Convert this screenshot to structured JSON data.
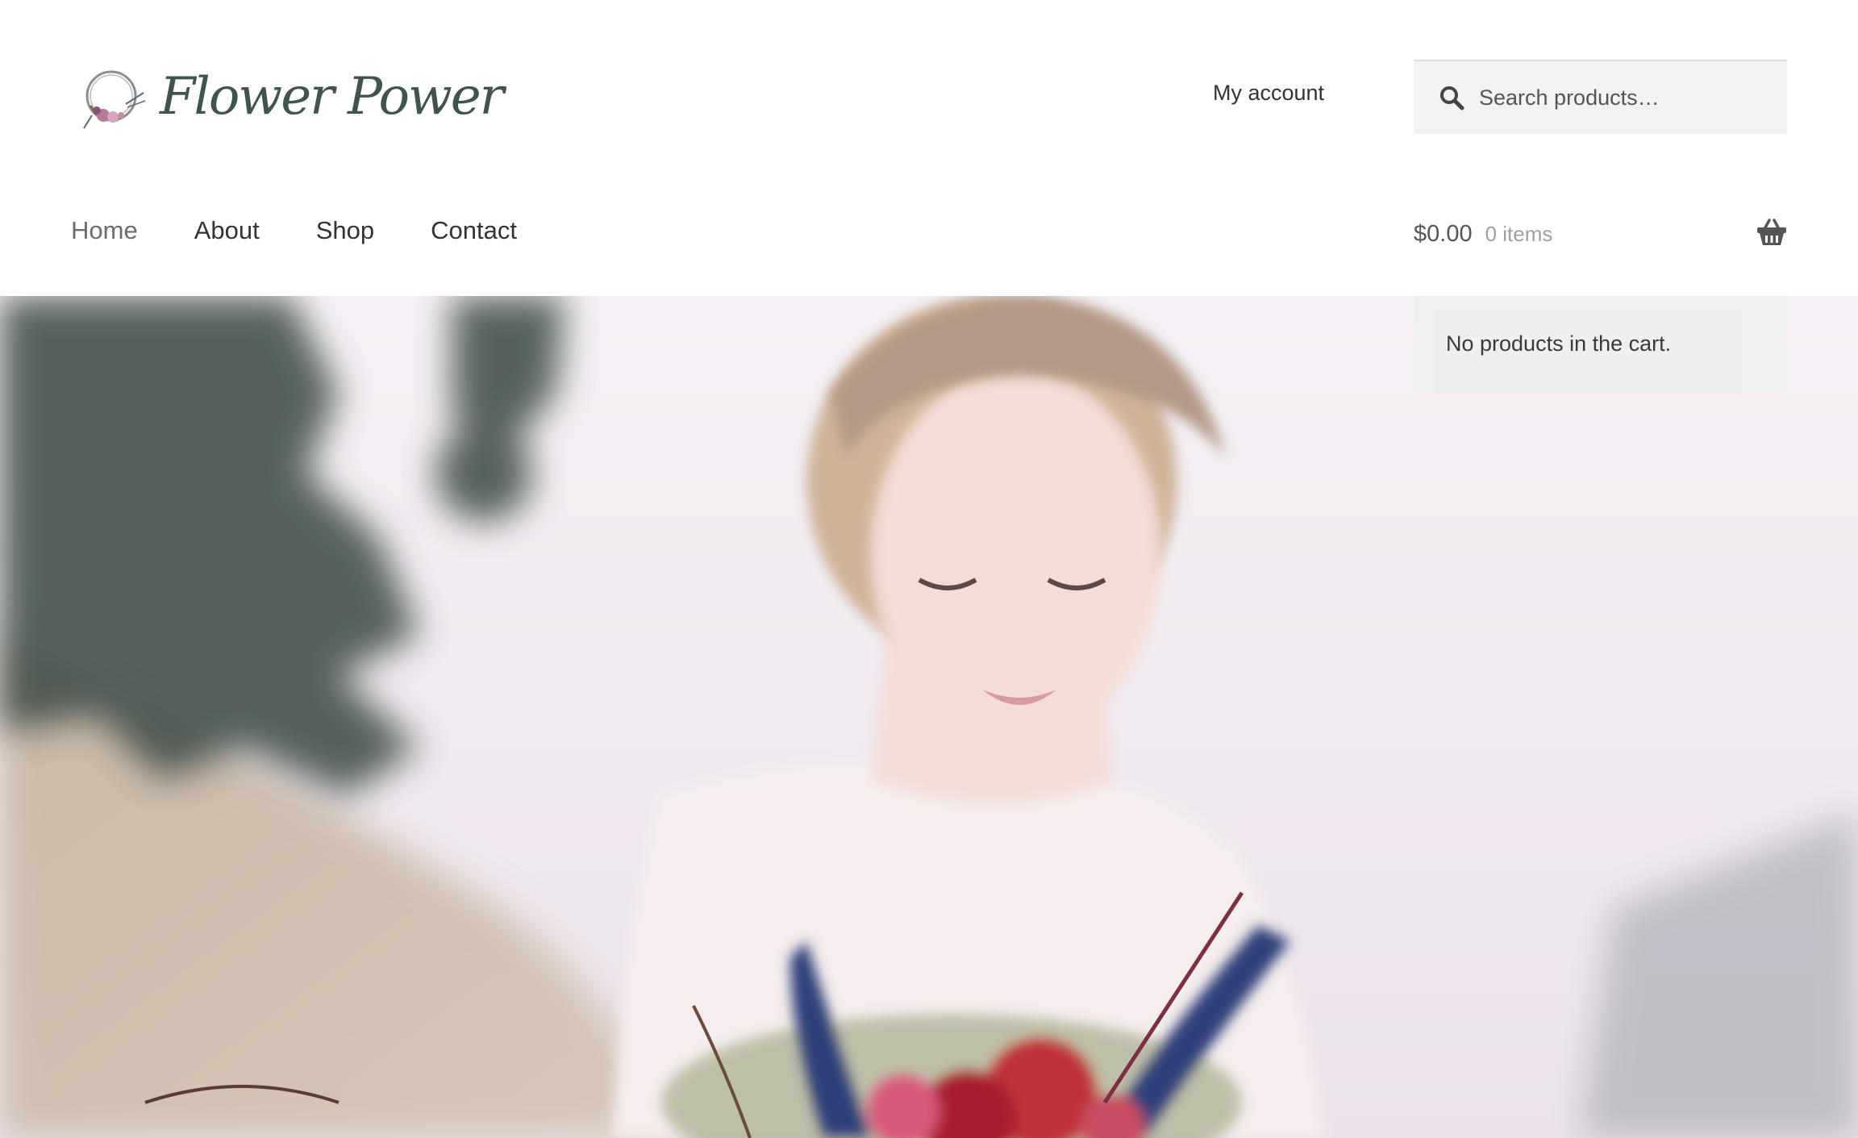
{
  "site": {
    "title": "Flower Power",
    "logo_icon": "flower-wreath-icon",
    "brand_color": "#3f5450"
  },
  "header": {
    "account_label": "My account",
    "search": {
      "placeholder": "Search products…",
      "value": "",
      "icon": "search-icon"
    }
  },
  "nav": {
    "items": [
      {
        "label": "Home",
        "current": true
      },
      {
        "label": "About",
        "current": false
      },
      {
        "label": "Shop",
        "current": false
      },
      {
        "label": "Contact",
        "current": false
      }
    ]
  },
  "cart": {
    "amount": "$0.00",
    "count": "0 items",
    "icon": "basket-icon",
    "dropdown_message": "No products in the cart."
  },
  "hero": {
    "image": "woman-with-flower-bouquet-photo"
  }
}
